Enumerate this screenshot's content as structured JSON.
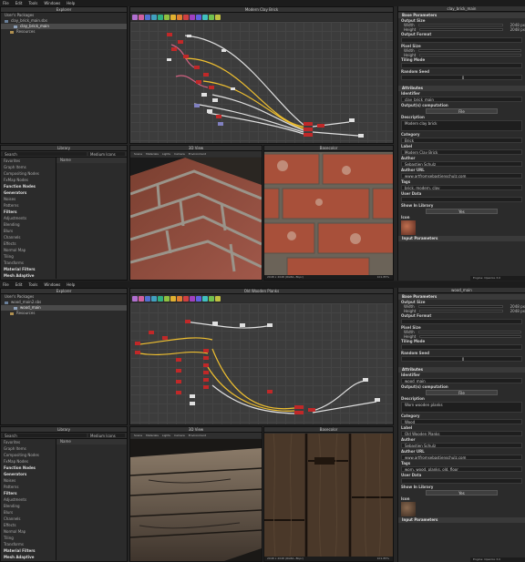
{
  "menu": [
    "File",
    "Edit",
    "Tools",
    "Windows",
    "Help"
  ],
  "top": {
    "explorer_title": "Explorer",
    "packages_header": "User's Packages",
    "package_name": "clay_brick_main.sbs",
    "graph_name": "clay_brick_main",
    "resources": "Resources",
    "graph_title": "Modern Clay Brick",
    "props_title": "clay_brick_main",
    "library_title": "Library",
    "view3d_title": "3D View",
    "view2d_title": "Basecolor",
    "view2d_status": "2048 x 2048 (RGBA, 8bpc)",
    "zoom": "101.85%",
    "view3d_tabs": [
      "Scene",
      "Materials",
      "Lights",
      "Camera",
      "Environment",
      "Display",
      "Renderer"
    ],
    "identifier": "clay_brick_main",
    "description": "Modern clay brick",
    "label": "Modern Clay Brick",
    "author": "Sebastien Schulz",
    "author_url": "www.artfromsebastienschulz.com",
    "tags": "brick, modern, clay",
    "engine": "Engine: OpenGL 3.0"
  },
  "bottom": {
    "explorer_title": "Explorer",
    "packages_header": "User's Packages",
    "package_name": "wood_main2.sbs",
    "graph_name": "wood_main",
    "resources": "Resources",
    "graph_title": "Old Wooden Planks",
    "props_title": "wood_main",
    "library_title": "Library",
    "view3d_title": "3D View",
    "view2d_title": "Basecolor",
    "view2d_status": "2048 x 2048 (RGBA, 8bpc)",
    "zoom": "101.85%",
    "view3d_tabs": [
      "Scene",
      "Materials",
      "Lights",
      "Camera",
      "Environment",
      "Display",
      "Renderer"
    ],
    "identifier": "wood_main",
    "description": "Worn wooden planks",
    "label": "Old Wooden Planks",
    "author": "Sebastien Schulz",
    "author_url": "www.artfromsebastienschulz.com",
    "tags": "worn, wood, planks, old, floor",
    "engine": "Engine: OpenGL 3.0"
  },
  "library": {
    "search_label": "Search",
    "col_name": "Name",
    "col_filter": "Medium Icons",
    "categories": [
      "Favorites",
      "Graph Items",
      "Compositing Nodes",
      "FxMap Nodes",
      "Function Nodes",
      "Generators",
      "Noises",
      "Patterns",
      "Filters",
      "Adjustments",
      "Blending",
      "Blurs",
      "Channels",
      "Effects",
      "Normal Map",
      "Tiling",
      "Transforms",
      "Material Filters",
      "Mesh Adaptive"
    ],
    "headers": [
      "Function Nodes",
      "Generators",
      "Filters",
      "Material Filters",
      "Mesh Adaptive"
    ]
  },
  "props": {
    "base_params": "Base Parameters",
    "output_size": "Output Size",
    "width": "Width",
    "height": "Height",
    "width_val": "2048 px",
    "height_val": "2048 px",
    "output_format": "Output Format",
    "pixel_size": "Pixel Size",
    "tiling_mode": "Tiling Mode",
    "random_seed": "Random Seed",
    "seed_val": "0",
    "attributes": "Attributes",
    "identifier": "Identifier",
    "output_comp": "Output(s) computation",
    "file_btn": "File",
    "description": "Description",
    "category": "Category",
    "category_val_top": "Brick",
    "category_val_bottom": "Wood",
    "label": "Label",
    "author": "Author",
    "author_url": "Author URL",
    "tags": "Tags",
    "user_data": "User Data",
    "show_in_library": "Show In Library",
    "yes_btn": "Yes",
    "icon": "Icon",
    "input_params": "Input Parameters"
  },
  "colors": {
    "accent": "#f2b020",
    "node_red": "#c02828",
    "wire_yellow": "#f0c030",
    "wire_white": "#e0e0e0"
  }
}
